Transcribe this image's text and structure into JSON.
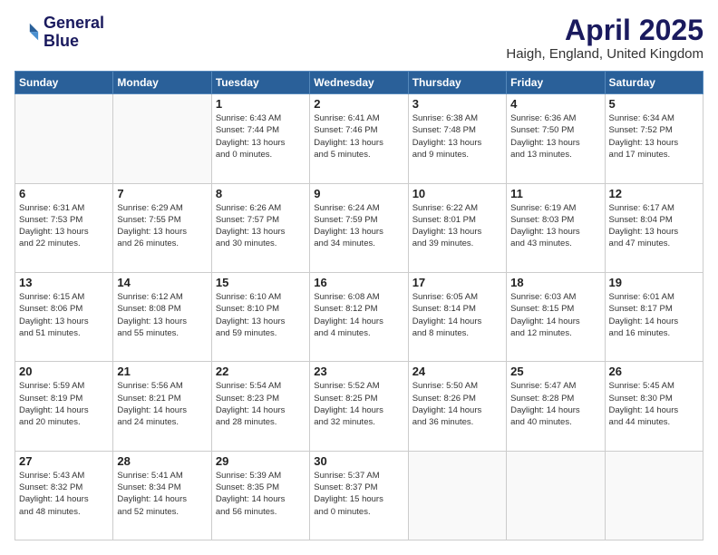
{
  "header": {
    "logo_line1": "General",
    "logo_line2": "Blue",
    "month": "April 2025",
    "location": "Haigh, England, United Kingdom"
  },
  "weekdays": [
    "Sunday",
    "Monday",
    "Tuesday",
    "Wednesday",
    "Thursday",
    "Friday",
    "Saturday"
  ],
  "weeks": [
    [
      {
        "day": "",
        "info": []
      },
      {
        "day": "",
        "info": []
      },
      {
        "day": "1",
        "info": [
          "Sunrise: 6:43 AM",
          "Sunset: 7:44 PM",
          "Daylight: 13 hours",
          "and 0 minutes."
        ]
      },
      {
        "day": "2",
        "info": [
          "Sunrise: 6:41 AM",
          "Sunset: 7:46 PM",
          "Daylight: 13 hours",
          "and 5 minutes."
        ]
      },
      {
        "day": "3",
        "info": [
          "Sunrise: 6:38 AM",
          "Sunset: 7:48 PM",
          "Daylight: 13 hours",
          "and 9 minutes."
        ]
      },
      {
        "day": "4",
        "info": [
          "Sunrise: 6:36 AM",
          "Sunset: 7:50 PM",
          "Daylight: 13 hours",
          "and 13 minutes."
        ]
      },
      {
        "day": "5",
        "info": [
          "Sunrise: 6:34 AM",
          "Sunset: 7:52 PM",
          "Daylight: 13 hours",
          "and 17 minutes."
        ]
      }
    ],
    [
      {
        "day": "6",
        "info": [
          "Sunrise: 6:31 AM",
          "Sunset: 7:53 PM",
          "Daylight: 13 hours",
          "and 22 minutes."
        ]
      },
      {
        "day": "7",
        "info": [
          "Sunrise: 6:29 AM",
          "Sunset: 7:55 PM",
          "Daylight: 13 hours",
          "and 26 minutes."
        ]
      },
      {
        "day": "8",
        "info": [
          "Sunrise: 6:26 AM",
          "Sunset: 7:57 PM",
          "Daylight: 13 hours",
          "and 30 minutes."
        ]
      },
      {
        "day": "9",
        "info": [
          "Sunrise: 6:24 AM",
          "Sunset: 7:59 PM",
          "Daylight: 13 hours",
          "and 34 minutes."
        ]
      },
      {
        "day": "10",
        "info": [
          "Sunrise: 6:22 AM",
          "Sunset: 8:01 PM",
          "Daylight: 13 hours",
          "and 39 minutes."
        ]
      },
      {
        "day": "11",
        "info": [
          "Sunrise: 6:19 AM",
          "Sunset: 8:03 PM",
          "Daylight: 13 hours",
          "and 43 minutes."
        ]
      },
      {
        "day": "12",
        "info": [
          "Sunrise: 6:17 AM",
          "Sunset: 8:04 PM",
          "Daylight: 13 hours",
          "and 47 minutes."
        ]
      }
    ],
    [
      {
        "day": "13",
        "info": [
          "Sunrise: 6:15 AM",
          "Sunset: 8:06 PM",
          "Daylight: 13 hours",
          "and 51 minutes."
        ]
      },
      {
        "day": "14",
        "info": [
          "Sunrise: 6:12 AM",
          "Sunset: 8:08 PM",
          "Daylight: 13 hours",
          "and 55 minutes."
        ]
      },
      {
        "day": "15",
        "info": [
          "Sunrise: 6:10 AM",
          "Sunset: 8:10 PM",
          "Daylight: 13 hours",
          "and 59 minutes."
        ]
      },
      {
        "day": "16",
        "info": [
          "Sunrise: 6:08 AM",
          "Sunset: 8:12 PM",
          "Daylight: 14 hours",
          "and 4 minutes."
        ]
      },
      {
        "day": "17",
        "info": [
          "Sunrise: 6:05 AM",
          "Sunset: 8:14 PM",
          "Daylight: 14 hours",
          "and 8 minutes."
        ]
      },
      {
        "day": "18",
        "info": [
          "Sunrise: 6:03 AM",
          "Sunset: 8:15 PM",
          "Daylight: 14 hours",
          "and 12 minutes."
        ]
      },
      {
        "day": "19",
        "info": [
          "Sunrise: 6:01 AM",
          "Sunset: 8:17 PM",
          "Daylight: 14 hours",
          "and 16 minutes."
        ]
      }
    ],
    [
      {
        "day": "20",
        "info": [
          "Sunrise: 5:59 AM",
          "Sunset: 8:19 PM",
          "Daylight: 14 hours",
          "and 20 minutes."
        ]
      },
      {
        "day": "21",
        "info": [
          "Sunrise: 5:56 AM",
          "Sunset: 8:21 PM",
          "Daylight: 14 hours",
          "and 24 minutes."
        ]
      },
      {
        "day": "22",
        "info": [
          "Sunrise: 5:54 AM",
          "Sunset: 8:23 PM",
          "Daylight: 14 hours",
          "and 28 minutes."
        ]
      },
      {
        "day": "23",
        "info": [
          "Sunrise: 5:52 AM",
          "Sunset: 8:25 PM",
          "Daylight: 14 hours",
          "and 32 minutes."
        ]
      },
      {
        "day": "24",
        "info": [
          "Sunrise: 5:50 AM",
          "Sunset: 8:26 PM",
          "Daylight: 14 hours",
          "and 36 minutes."
        ]
      },
      {
        "day": "25",
        "info": [
          "Sunrise: 5:47 AM",
          "Sunset: 8:28 PM",
          "Daylight: 14 hours",
          "and 40 minutes."
        ]
      },
      {
        "day": "26",
        "info": [
          "Sunrise: 5:45 AM",
          "Sunset: 8:30 PM",
          "Daylight: 14 hours",
          "and 44 minutes."
        ]
      }
    ],
    [
      {
        "day": "27",
        "info": [
          "Sunrise: 5:43 AM",
          "Sunset: 8:32 PM",
          "Daylight: 14 hours",
          "and 48 minutes."
        ]
      },
      {
        "day": "28",
        "info": [
          "Sunrise: 5:41 AM",
          "Sunset: 8:34 PM",
          "Daylight: 14 hours",
          "and 52 minutes."
        ]
      },
      {
        "day": "29",
        "info": [
          "Sunrise: 5:39 AM",
          "Sunset: 8:35 PM",
          "Daylight: 14 hours",
          "and 56 minutes."
        ]
      },
      {
        "day": "30",
        "info": [
          "Sunrise: 5:37 AM",
          "Sunset: 8:37 PM",
          "Daylight: 15 hours",
          "and 0 minutes."
        ]
      },
      {
        "day": "",
        "info": []
      },
      {
        "day": "",
        "info": []
      },
      {
        "day": "",
        "info": []
      }
    ]
  ]
}
